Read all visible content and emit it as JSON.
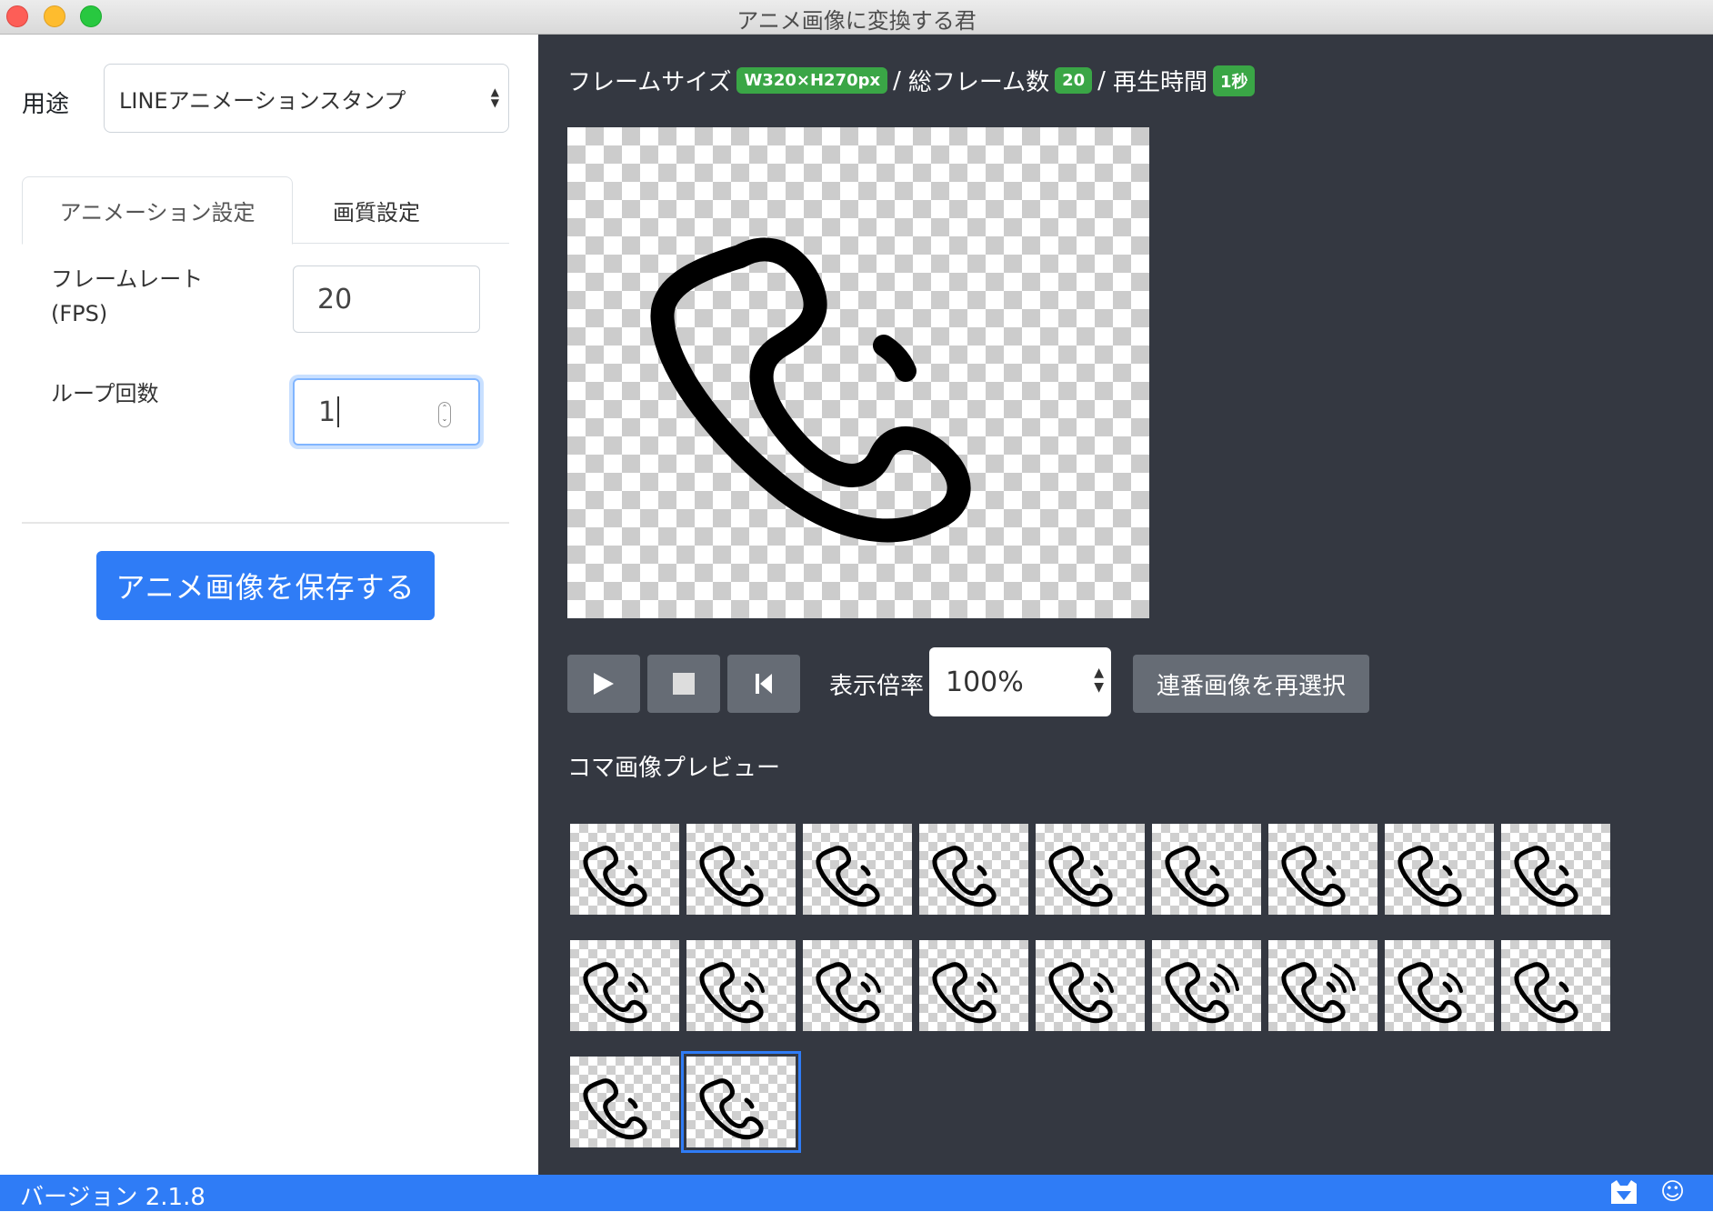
{
  "window": {
    "title": "アニメ画像に変換する君"
  },
  "left": {
    "usage_label": "用途",
    "usage_value": "LINEアニメーションスタンプ",
    "tabs": [
      {
        "label": "アニメーション設定"
      },
      {
        "label": "画質設定"
      }
    ],
    "fps_label_line1": "フレームレート",
    "fps_label_line2": "(FPS)",
    "fps_value": "20",
    "loop_label": "ループ回数",
    "loop_value": "1",
    "save_label": "アニメ画像を保存する"
  },
  "right": {
    "frame_size_label": "フレームサイズ",
    "frame_size_value": "W320×H270px",
    "sep1": "/",
    "total_frames_label": "総フレーム数",
    "total_frames_value": "20",
    "sep2": "/",
    "duration_label": "再生時間",
    "duration_value": "1秒",
    "scale_label": "表示倍率",
    "scale_value": "100%",
    "reselect_label": "連番画像を再選択",
    "preview_section_label": "コマ画像プレビュー",
    "thumbnail_count": 20,
    "selected_thumbnail_index": 19
  },
  "statusbar": {
    "version": "バージョン 2.1.8"
  },
  "colors": {
    "accent": "#2f7cf6",
    "dark_panel": "#343841",
    "badge_green": "#3aa646"
  }
}
